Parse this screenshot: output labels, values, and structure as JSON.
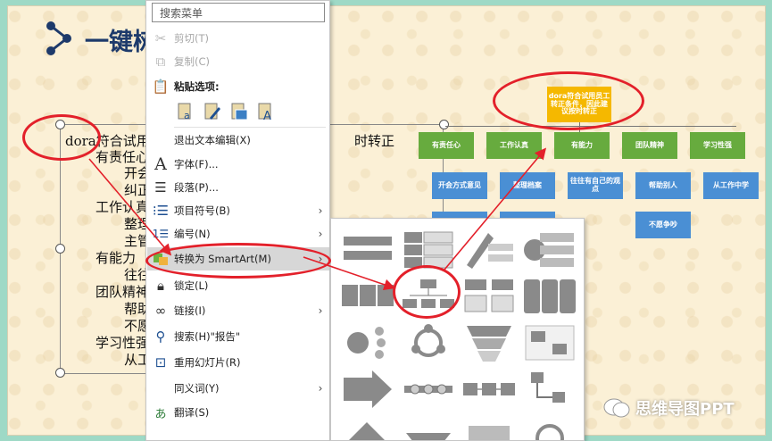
{
  "slide": {
    "title": "一键树",
    "outline": [
      {
        "text": "dora符合试用月",
        "level": 0
      },
      {
        "text": "时转正",
        "level": 0
      },
      {
        "text": "有责任心",
        "level": 1
      },
      {
        "text": "开会",
        "level": 2
      },
      {
        "text": "纠正",
        "level": 2
      },
      {
        "text": "工作认真",
        "level": 1
      },
      {
        "text": "整理",
        "level": 2
      },
      {
        "text": "主管",
        "level": 2
      },
      {
        "text": "有能力",
        "level": 1
      },
      {
        "text": "往往",
        "level": 2
      },
      {
        "text": "团队精神",
        "level": 1
      },
      {
        "text": "帮助",
        "level": 2
      },
      {
        "text": "不愿",
        "level": 2
      },
      {
        "text": "学习性强",
        "level": 1
      },
      {
        "text": "从工",
        "level": 2
      }
    ]
  },
  "org_chart": {
    "root": "dora符合试用员工转正条件，因此建议按时转正",
    "level1": [
      "有责任心",
      "工作认真",
      "有能力",
      "团队精神",
      "学习性强"
    ],
    "level2": [
      {
        "parent": 0,
        "items": [
          "开会方式意见",
          ""
        ]
      },
      {
        "parent": 1,
        "items": [
          "整理档案",
          ""
        ]
      },
      {
        "parent": 2,
        "items": [
          "往往有自己的观点"
        ]
      },
      {
        "parent": 3,
        "items": [
          "帮助别人",
          "不愿争吵"
        ]
      },
      {
        "parent": 4,
        "items": [
          "从工作中学"
        ]
      }
    ]
  },
  "context_menu": {
    "search_placeholder": "搜索菜单",
    "items": [
      {
        "label": "剪切(T)",
        "icon": "scissors-icon",
        "disabled": true
      },
      {
        "label": "复制(C)",
        "icon": "copy-icon",
        "disabled": true
      },
      {
        "label": "粘贴选项:",
        "icon": "clipboard-icon",
        "bold": true
      },
      {
        "label": "退出文本编辑(X)",
        "icon": ""
      },
      {
        "label": "字体(F)...",
        "icon": "font-icon"
      },
      {
        "label": "段落(P)...",
        "icon": "paragraph-icon"
      },
      {
        "label": "项目符号(B)",
        "icon": "bullets-icon",
        "submenu": true
      },
      {
        "label": "编号(N)",
        "icon": "numbering-icon",
        "submenu": true
      },
      {
        "label": "转换为 SmartArt(M)",
        "icon": "smartart-icon",
        "submenu": true,
        "highlighted": true
      },
      {
        "label": "锁定(L)",
        "icon": "lock-icon"
      },
      {
        "label": "链接(I)",
        "icon": "link-icon",
        "submenu": true
      },
      {
        "label": "搜索(H)\"报告\"",
        "icon": "search-icon"
      },
      {
        "label": "重用幻灯片(R)",
        "icon": "reuse-slides-icon"
      },
      {
        "label": "同义词(Y)",
        "icon": "",
        "submenu": true
      },
      {
        "label": "翻译(S)",
        "icon": "translate-icon"
      }
    ]
  },
  "watermark": {
    "text": "思维导图PPT"
  },
  "colors": {
    "root_node": "#f5b800",
    "level1_node": "#67ab3e",
    "level2_node": "#4a8fd4",
    "annotation_red": "#e3202a",
    "highlight": "#d7d7d7"
  }
}
